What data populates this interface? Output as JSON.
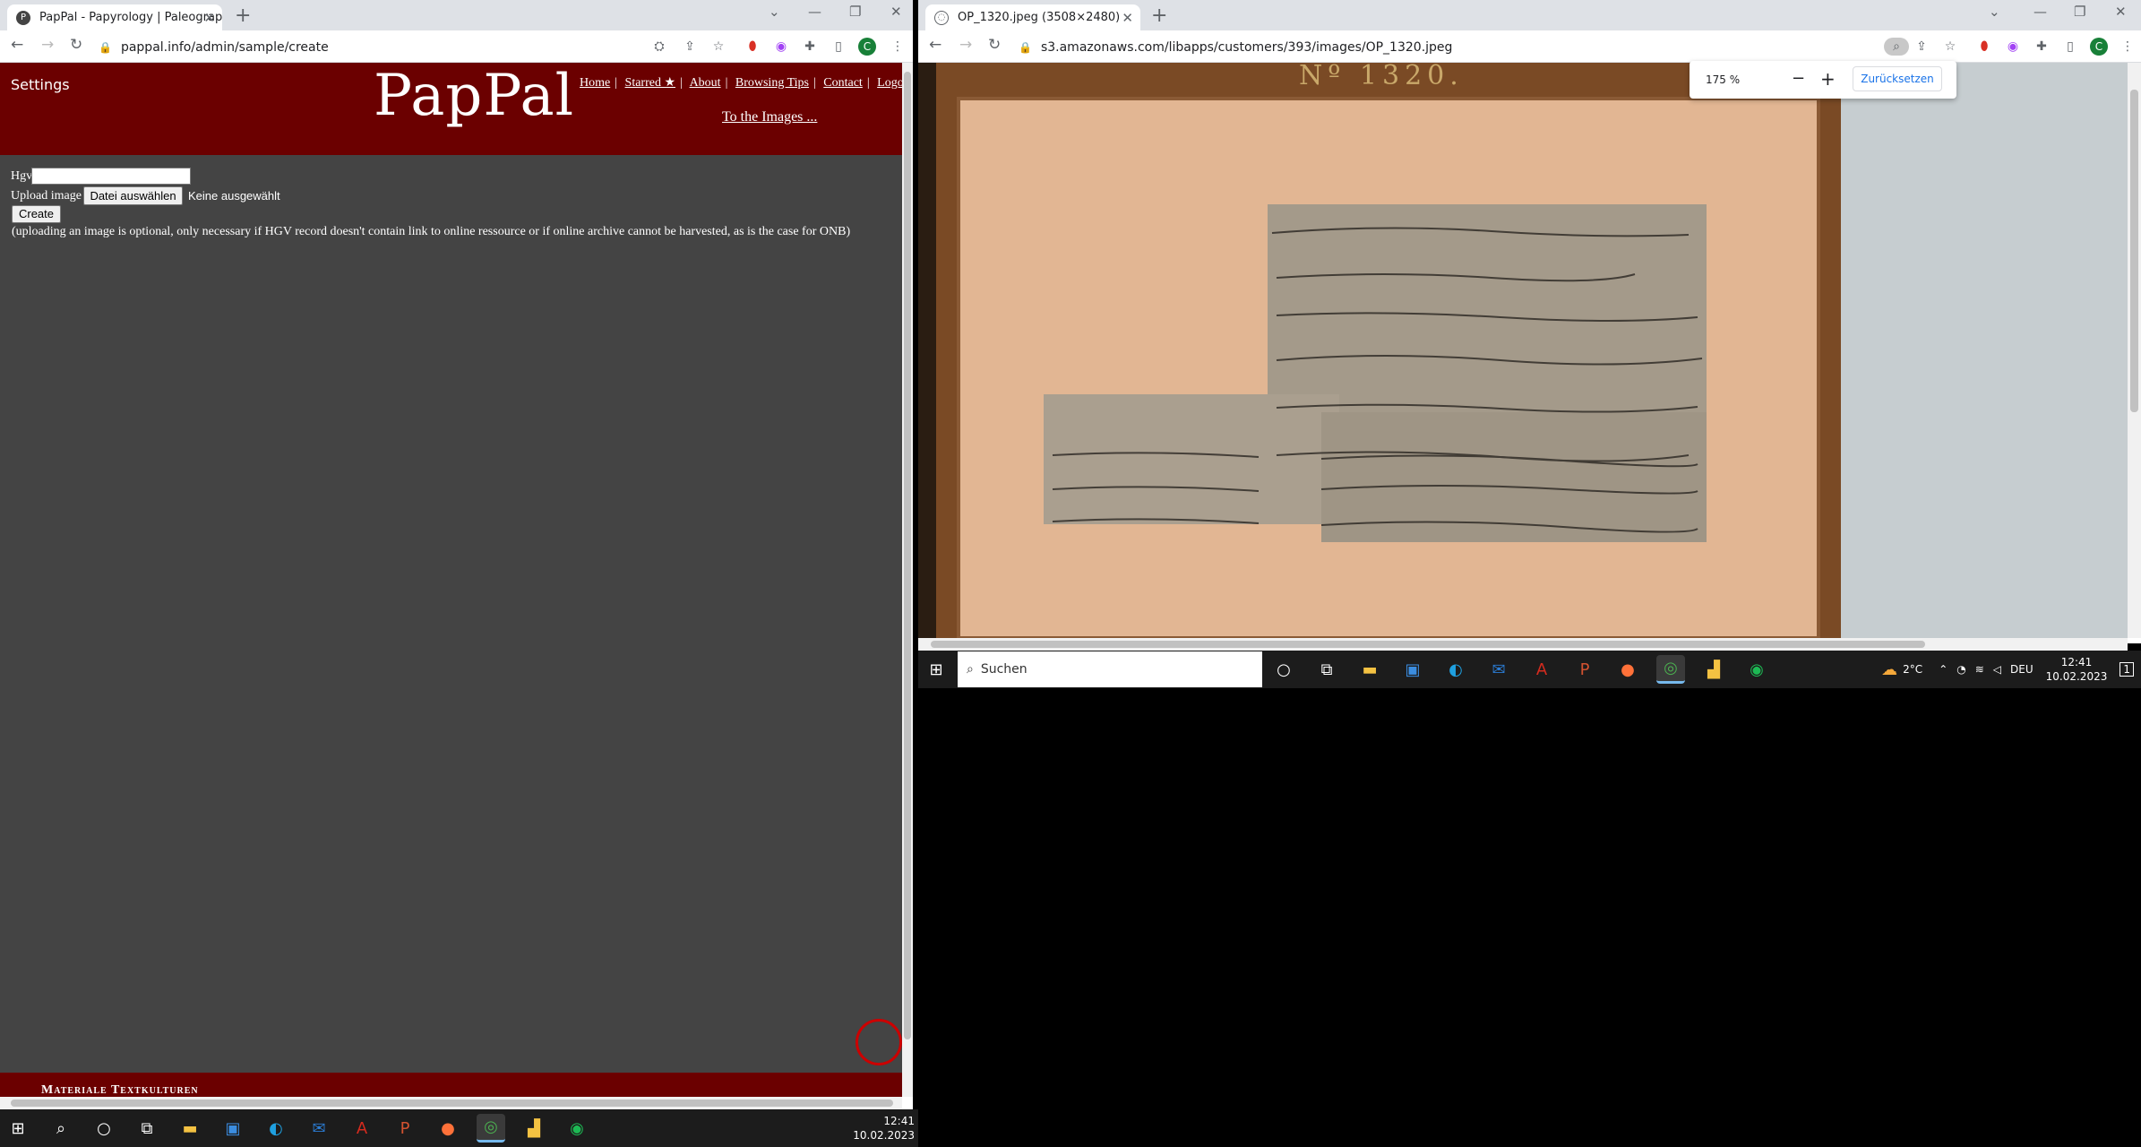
{
  "left_window": {
    "tab_title": "PapPal - Papyrology | Paleograph",
    "tab_favicon": "P",
    "url": "pappal.info/admin/sample/create",
    "page": {
      "settings_label": "Settings",
      "logo": "PapPal",
      "nav": [
        "Home",
        "Starred ★",
        "About",
        "Browsing Tips",
        "Contact",
        "Logou"
      ],
      "to_images": "To the Images ...",
      "hgv_label": "Hgv",
      "upload_label": "Upload image",
      "file_button": "Datei auswählen",
      "no_file": "Keine ausgewählt",
      "create_button": "Create",
      "note": "(uploading an image is optional, only necessary if HGV record doesn't contain link to online ressource or if online archive cannot be harvested, as is the case for ONB)",
      "footer": "Materiale Textkulturen"
    },
    "avatar_letter": "C"
  },
  "right_window": {
    "tab_title": "OP_1320.jpeg (3508×2480)",
    "url": "s3.amazonaws.com/libapps/customers/393/images/OP_1320.jpeg",
    "zoom": {
      "level": "175 %",
      "minus": "−",
      "plus": "+",
      "reset": "Zurücksetzen"
    },
    "image_label": "Nº 1320.",
    "avatar_letter": "C"
  },
  "taskbar_left": {
    "time": "12:41",
    "date": "10.02.2023"
  },
  "taskbar_right": {
    "search_placeholder": "Suchen",
    "weather": "2°C",
    "lang": "DEU",
    "time": "12:41",
    "date": "10.02.2023",
    "notif": "1"
  },
  "colors": {
    "banner": "#6b0000",
    "page_bg": "#444444",
    "taskbar": "#1c1c1c",
    "chrome_tabstrip": "#dee1e6"
  }
}
